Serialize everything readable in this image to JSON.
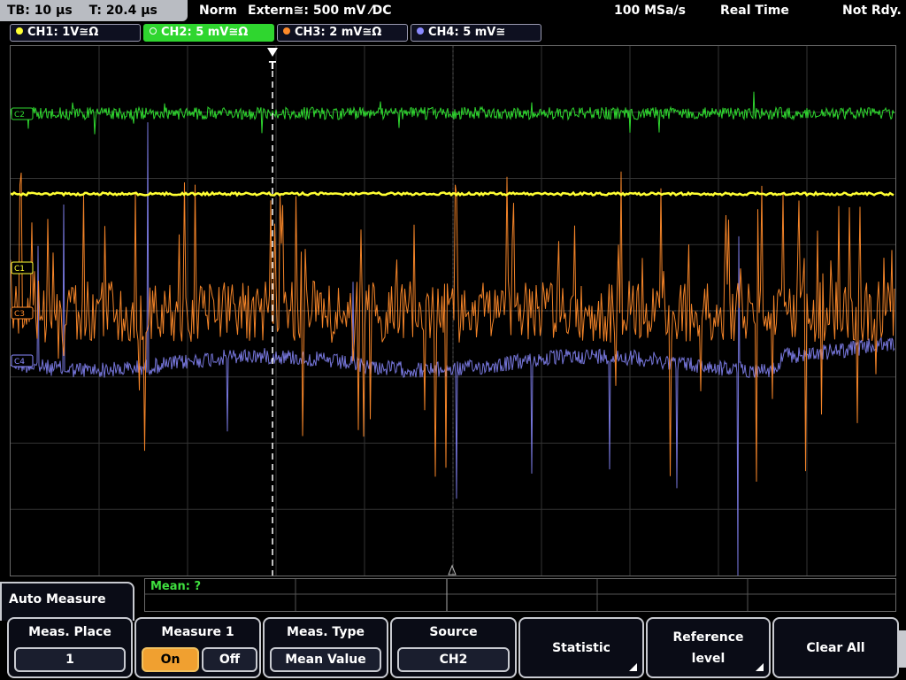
{
  "status": {
    "tb": "TB: 10 µs",
    "t": "T: 20.4 µs",
    "mode": "Norm",
    "trigger": "Extern≅: 500 mV ⁄DC",
    "rate": "100 MSa/s",
    "realtime": "Real Time",
    "ready": "Not Rdy."
  },
  "channels": [
    {
      "label": "CH1: 1V≅Ω",
      "color": "#ffff33"
    },
    {
      "label": "CH2: 5 mV≅Ω",
      "color": "#2fd62f"
    },
    {
      "label": "CH3: 2 mV≅Ω",
      "color": "#ff8a2a"
    },
    {
      "label": "CH4: 5 mV≅",
      "color": "#8a8aff"
    }
  ],
  "markers": {
    "c2": "C2",
    "c1": "C1",
    "c3": "C3",
    "c4": "C4",
    "trigger": "T"
  },
  "measurement": {
    "mean": "Mean: ?"
  },
  "auto_measure": "Auto Measure",
  "softkeys": {
    "meas_place": {
      "caption": "Meas. Place",
      "value": "1"
    },
    "measure1": {
      "caption": "Measure 1",
      "on": "On",
      "off": "Off"
    },
    "meas_type": {
      "caption": "Meas. Type",
      "value": "Mean Value"
    },
    "source": {
      "caption": "Source",
      "value": "CH2"
    },
    "statistic": {
      "caption": "Statistic"
    },
    "reference": {
      "line1": "Reference",
      "line2": "level"
    },
    "clear_all": {
      "caption": "Clear All"
    }
  }
}
